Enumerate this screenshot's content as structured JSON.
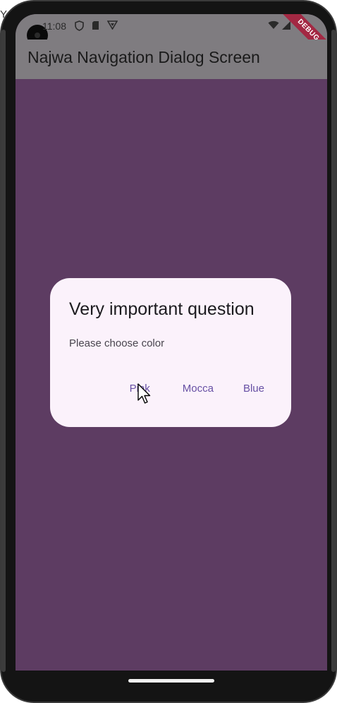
{
  "edge": {
    "text": "Yo"
  },
  "status_bar": {
    "time": "11:08",
    "icons": [
      "shield-icon",
      "sim-card-icon",
      "vpn-icon",
      "wifi-icon",
      "signal-icon"
    ]
  },
  "app_bar": {
    "title": "Najwa Navigation Dialog Screen"
  },
  "debug_banner": {
    "label": "DEBUG"
  },
  "dialog": {
    "title": "Very important question",
    "content": "Please choose color",
    "actions": [
      {
        "label": "Pink"
      },
      {
        "label": "Mocca"
      },
      {
        "label": "Blue"
      }
    ]
  },
  "colors": {
    "background": "#5d3c62",
    "app_bar": "#7f7c80",
    "dialog": "#fbf2fb",
    "button_text": "#6750a4",
    "debug": "#a32843"
  }
}
